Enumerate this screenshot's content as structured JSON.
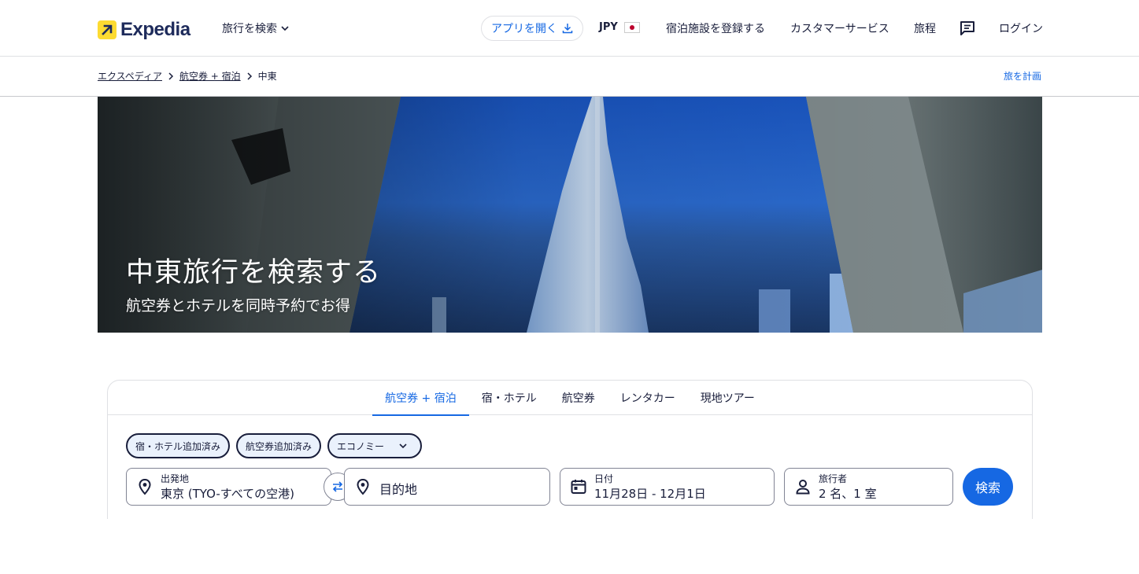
{
  "header": {
    "logo_text": "Expedia",
    "trip_search_label": "旅行を検索",
    "open_app_label": "アプリを開く",
    "currency_label": "JPY",
    "list_property_label": "宿泊施設を登録する",
    "customer_service_label": "カスタマーサービス",
    "itinerary_label": "旅程",
    "login_label": "ログイン"
  },
  "breadcrumb": {
    "items": [
      "エクスペディア",
      "航空券 + 宿泊",
      "中東"
    ],
    "plan_trip_label": "旅を計画"
  },
  "hero": {
    "title": "中東旅行を検索する",
    "subtitle": "航空券とホテルを同時予約でお得"
  },
  "search": {
    "tabs": [
      {
        "label": "航空券 + 宿泊",
        "active": true
      },
      {
        "label": "宿・ホテル",
        "active": false
      },
      {
        "label": "航空券",
        "active": false
      },
      {
        "label": "レンタカー",
        "active": false
      },
      {
        "label": "現地ツアー",
        "active": false
      }
    ],
    "chips": {
      "stay_added": "宿・ホテル追加済み",
      "flight_added": "航空券追加済み",
      "cabin_class": "エコノミー"
    },
    "origin": {
      "label": "出発地",
      "value": "東京 (TYO-すべての空港)"
    },
    "destination": {
      "placeholder": "目的地"
    },
    "dates": {
      "label": "日付",
      "value": "11月28日 - 12月1日"
    },
    "travelers": {
      "label": "旅行者",
      "value": "2 名、1 室"
    },
    "search_button": "検索"
  },
  "colors": {
    "accent": "#1668e3",
    "logo_yellow": "#fddb32",
    "text": "#191e3b"
  }
}
